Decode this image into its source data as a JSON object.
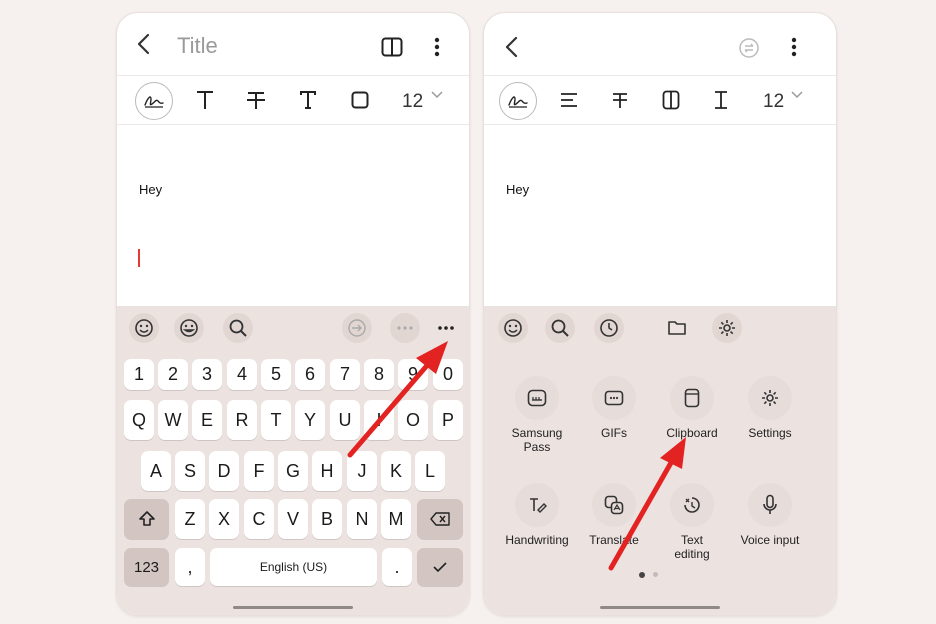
{
  "left_screen": {
    "title_placeholder": "Title",
    "font_size": "12",
    "body_text": "Hey",
    "keyboard": {
      "number_row": [
        "1",
        "2",
        "3",
        "4",
        "5",
        "6",
        "7",
        "8",
        "9",
        "0"
      ],
      "row1": [
        "Q",
        "W",
        "E",
        "R",
        "T",
        "Y",
        "U",
        "I",
        "O",
        "P"
      ],
      "row2": [
        "A",
        "S",
        "D",
        "F",
        "G",
        "H",
        "J",
        "K",
        "L"
      ],
      "row3": [
        "Z",
        "X",
        "C",
        "V",
        "B",
        "N",
        "M"
      ],
      "symbols_key": "123",
      "comma_key": ",",
      "space_label": "English (US)",
      "period_key": "."
    }
  },
  "right_screen": {
    "font_size": "12",
    "body_text": "Hey",
    "tools": [
      {
        "label": "Samsung Pass",
        "icon": "samsung-pass-icon"
      },
      {
        "label": "GIFs",
        "icon": "gif-icon"
      },
      {
        "label": "Clipboard",
        "icon": "clipboard-icon"
      },
      {
        "label": "Settings",
        "icon": "gear-icon"
      },
      {
        "label": "Handwriting",
        "icon": "handwriting-icon"
      },
      {
        "label": "Translate",
        "icon": "translate-icon"
      },
      {
        "label": "Text editing",
        "icon": "text-editing-icon"
      },
      {
        "label": "Voice input",
        "icon": "microphone-icon"
      }
    ]
  },
  "colors": {
    "background": "#f6f1ee",
    "keyboard_bg": "#ece2df",
    "arrow": "#e32222",
    "cursor": "#e53935"
  }
}
